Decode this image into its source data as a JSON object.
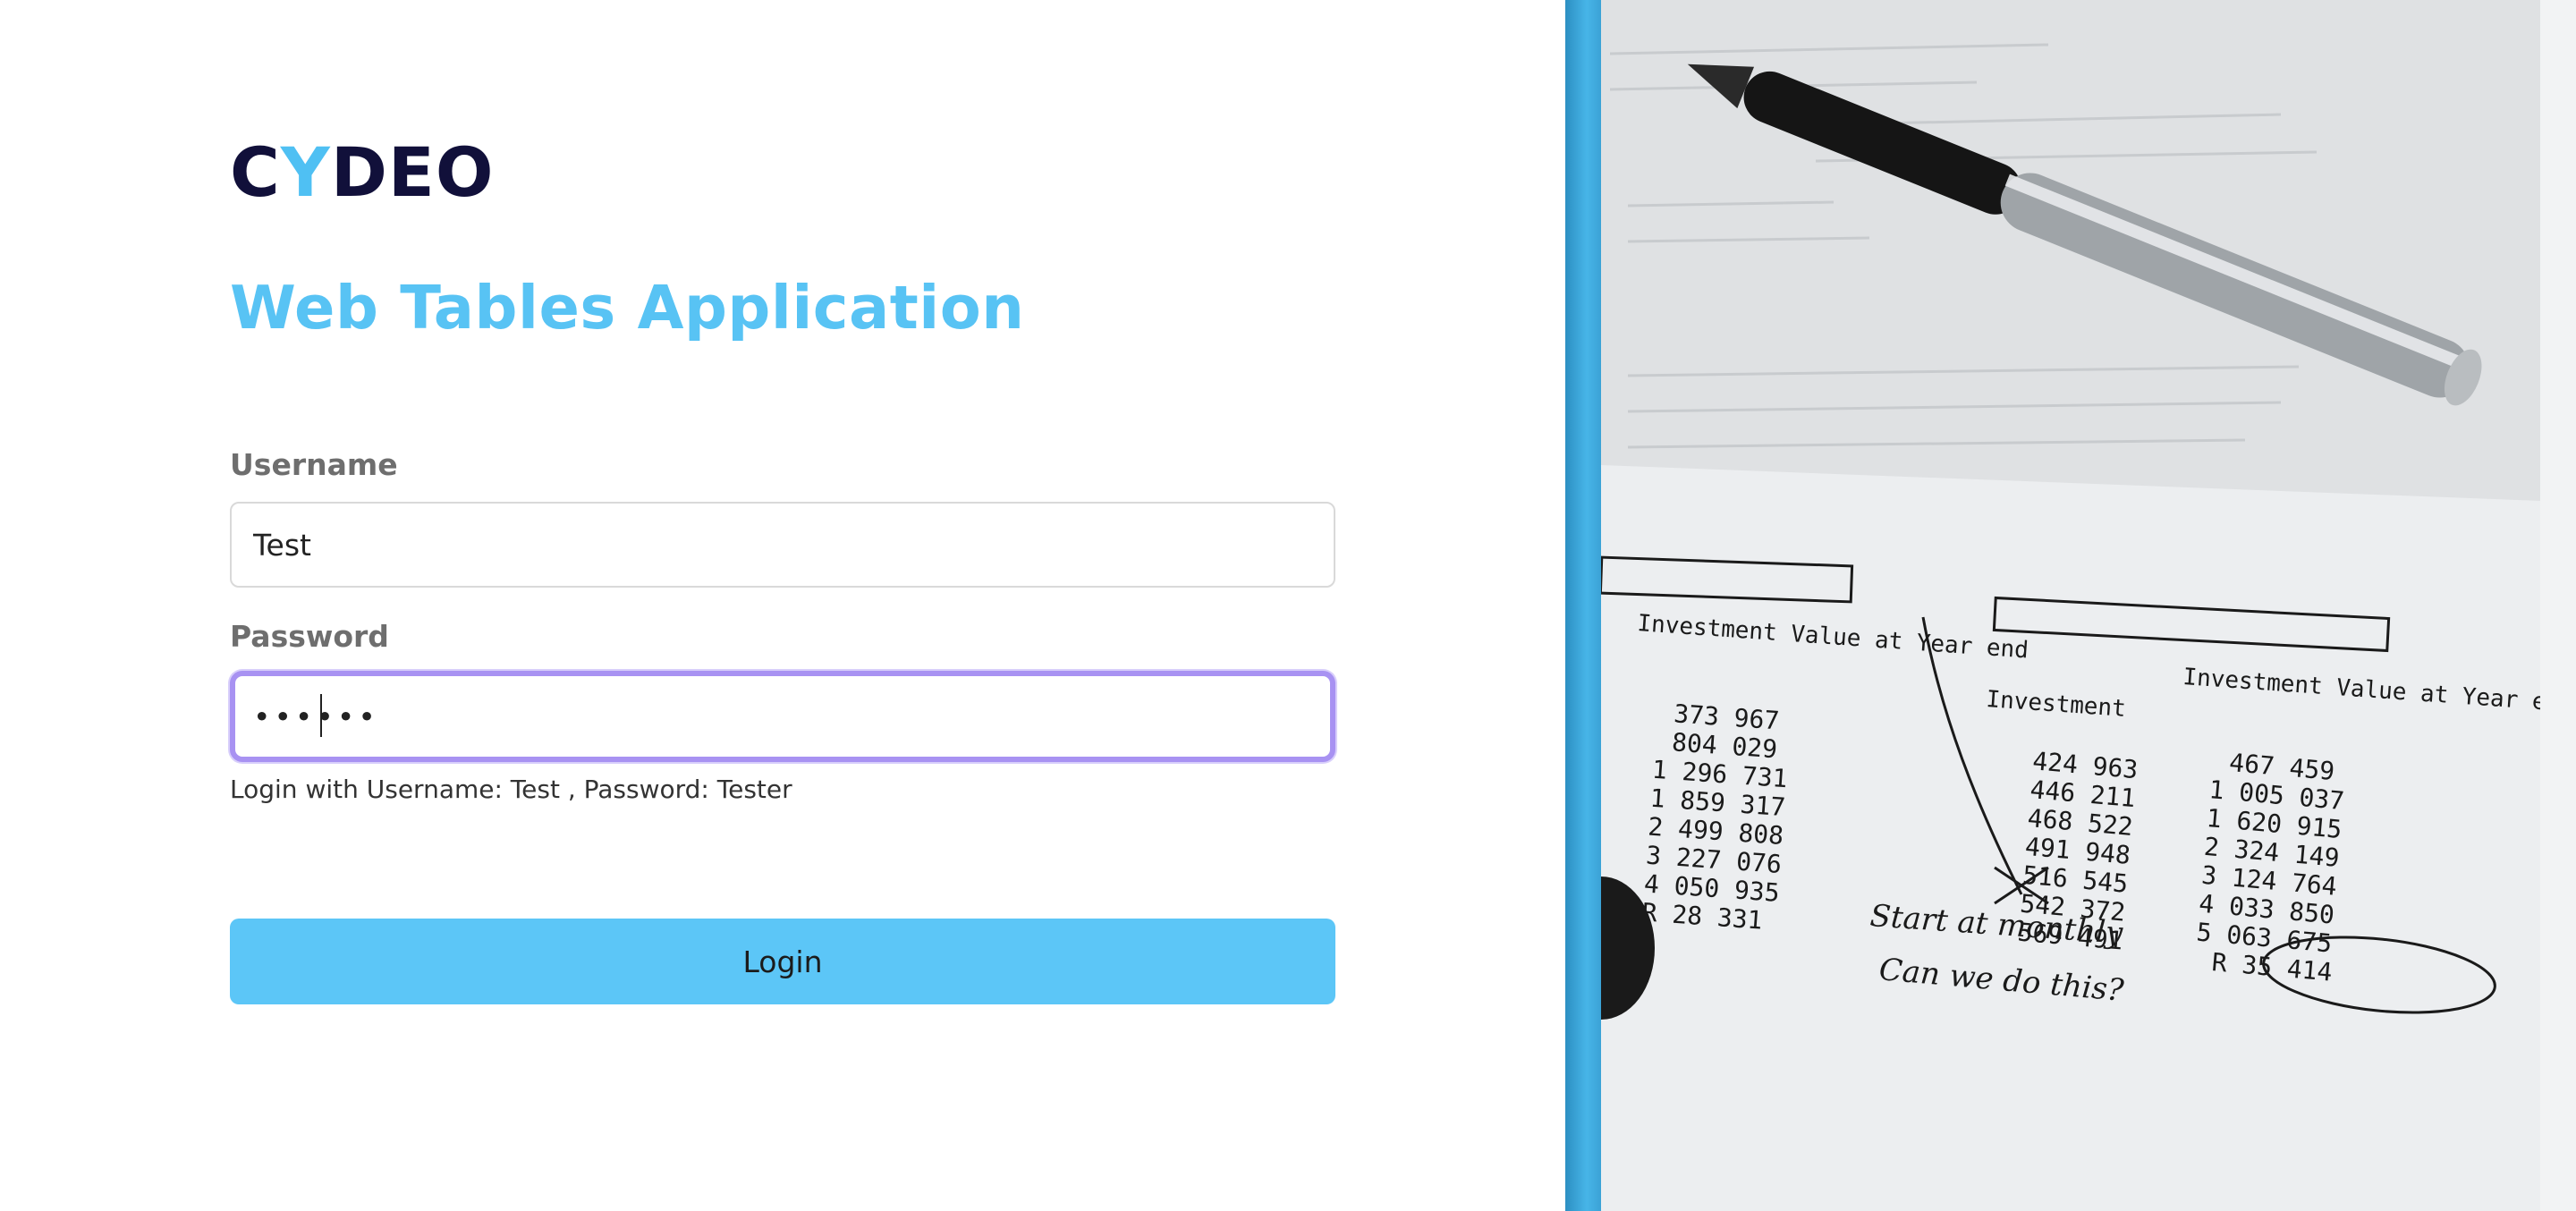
{
  "brand": {
    "logo_text_part1": "C",
    "logo_text_part2": "Y",
    "logo_text_part3": "DEO",
    "primary_color": "#11103a",
    "accent_color": "#4fc0f3"
  },
  "page": {
    "title": "Web Tables Application"
  },
  "form": {
    "username_label": "Username",
    "username_value": "Test",
    "password_label": "Password",
    "password_value": "••••••",
    "hint": "Login with Username: Test , Password: Tester",
    "login_label": "Login",
    "focus_color": "#a892f2",
    "button_color": "#5cc6f7"
  },
  "photo": {
    "icon": "document-with-pen-photo",
    "box_label_1": "Investment",
    "box_label_2": "Investment Value at Year end",
    "heading_left": "Investment Value at Year end",
    "heading_mid": "Investment",
    "heading_right": "Investment Value at Year end",
    "left_values": [
      "373 967",
      "804 029",
      "1 296 731",
      "1 859 317",
      "2 499 808",
      "3 227 076",
      "4 050 935",
      "R 28 331"
    ],
    "mid_values": [
      "424 963",
      "446 211",
      "468 522",
      "491 948",
      "516 545",
      "542 372",
      "569 491"
    ],
    "right_values": [
      "467 459",
      "1 005 037",
      "1 620 915",
      "2 324 149",
      "3 124 764",
      "4 033 850",
      "5 063 675",
      "R 35 414"
    ],
    "note_1": "Start at monthly",
    "note_2": "Can we do this?"
  }
}
